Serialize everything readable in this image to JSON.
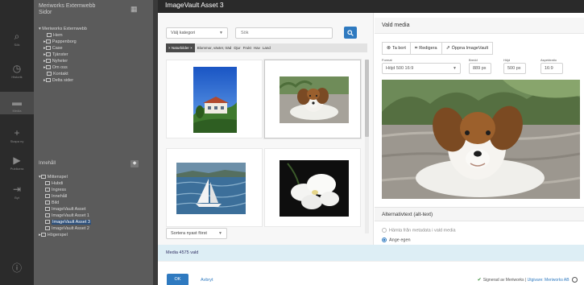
{
  "background": {
    "rail": [
      {
        "icon": "search-icon",
        "glyph": "⌕",
        "label": "Sök"
      },
      {
        "icon": "history-icon",
        "glyph": "◷",
        "label": "Historik"
      },
      {
        "icon": "folder-icon",
        "glyph": "▬",
        "label": "Media"
      },
      {
        "icon": "add-icon",
        "glyph": "+",
        "label": "Skapa ny"
      },
      {
        "icon": "publish-icon",
        "glyph": "▶",
        "label": "Publicera"
      },
      {
        "icon": "logout-icon",
        "glyph": "⇥",
        "label": "Byt"
      },
      {
        "icon": "info-icon",
        "glyph": "ⓘ",
        "label": ""
      }
    ],
    "site_title_line1": "Meriworks Extemwebb",
    "site_title_line2": "Sidor",
    "tree": [
      "Meriworks Externwebb",
      "Hem",
      "Pappenborg",
      "Case",
      "Tjänster",
      "Nyheter",
      "Om oss",
      "Kontakt",
      "Delta sider"
    ],
    "media_title": "Innehåll",
    "media_tree": [
      "Mittenspel",
      "Hubdi",
      "Ingress",
      "Innehåll",
      "Bild",
      "ImageVault Asset",
      "ImageVault Asset 1",
      "ImageVault Asset 3",
      "ImageVault Asset 2",
      "Högerspel"
    ],
    "media_selected_index": 7
  },
  "modal": {
    "title": "ImageVault Asset 3",
    "left": {
      "category_select": "Välj kategori",
      "search_placeholder": "Sök",
      "filter_chip": "Naturbilder",
      "filter_tags": [
        "Blommor, växter, träd",
        "Djur",
        "Frukt",
        "Hav",
        "Land"
      ],
      "thumbnails": [
        {
          "name": "house-photo",
          "desc": "hillside villa"
        },
        {
          "name": "dog-photo",
          "desc": "dog on rug"
        },
        {
          "name": "sailboat-photo",
          "desc": "sailboat on sea"
        },
        {
          "name": "orchid-photo",
          "desc": "white orchid"
        }
      ],
      "selected_index": 1,
      "sort_select": "Sortera nyast först"
    },
    "right": {
      "heading": "Vald media",
      "buttons": [
        {
          "icon": "remove-icon",
          "glyph": "⊗",
          "label": "Ta bort"
        },
        {
          "icon": "edit-icon",
          "glyph": "⌗",
          "label": "Redigera"
        },
        {
          "icon": "external-link-icon",
          "glyph": "⇗",
          "label": "Öppna ImageVault"
        }
      ],
      "format_label": "Format",
      "format_value": "Höjd 500 16:9",
      "width_label": "Bredd",
      "width_value": "889 px",
      "height_label": "Höjd",
      "height_value": "500 px",
      "ratio_label": "Aspektratio",
      "ratio_value": "16:9",
      "alt_heading": "Alternativtext (alt-text)",
      "alt_options": [
        {
          "label": "Hämta från metadata i vald media",
          "selected": false
        },
        {
          "label": "Ange egen",
          "selected": true
        }
      ]
    },
    "status": "Media 4575 vald",
    "ok_label": "OK",
    "cancel_label": "Avbryt",
    "signed_prefix": "Signerad av Meriworks |",
    "signed_link": "Utgivare: Meriworks AB",
    "colors": {
      "accent": "#2f7ac0",
      "status_bg": "#ddeef5",
      "title_bar": "#2a2a2a"
    }
  }
}
